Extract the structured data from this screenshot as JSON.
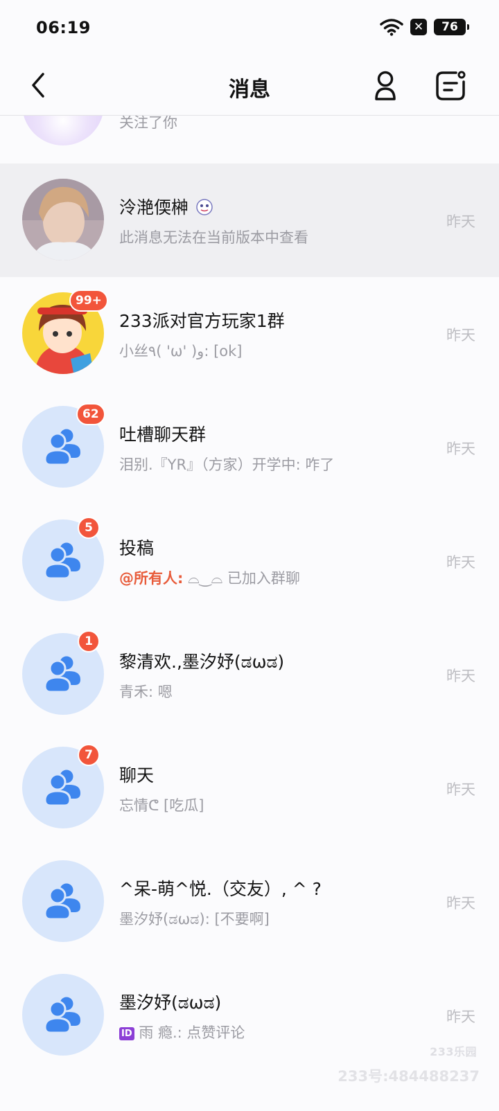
{
  "status_bar": {
    "time": "06:19",
    "battery": "76",
    "wifi_icon": "wifi-icon",
    "x_icon": "close-box-icon"
  },
  "header": {
    "title": "消息",
    "back_icon": "chevron-left-icon",
    "user_icon": "person-icon",
    "message_icon": "message-settings-icon"
  },
  "partial_item": {
    "subtitle": "关注了你"
  },
  "conversations": [
    {
      "title": "泠滟偄榊",
      "subtitle": "此消息无法在当前版本中查看",
      "time": "昨天"
    },
    {
      "title": "233派对官方玩家1群",
      "subtitle": "小丝٩( 'ω' )و: [ok]",
      "time": "昨天",
      "badge": "99+"
    },
    {
      "title": "吐槽聊天群",
      "subtitle": "泪别.『YR』（方家）开学中: 咋了",
      "time": "昨天",
      "badge": "62"
    },
    {
      "title": "投稿",
      "mention": "@所有人:",
      "subtitle": "⌓‿⌓ 已加入群聊",
      "time": "昨天",
      "badge": "5"
    },
    {
      "title": "黎清欢.,墨汐妤(ಡωಡ)",
      "subtitle": "青禾: 嗯",
      "time": "昨天",
      "badge": "1"
    },
    {
      "title": "聊天",
      "subtitle": "忘情ᕦ [吃瓜]",
      "time": "昨天",
      "badge": "7"
    },
    {
      "title": "^呆-萌^悦.（交友）, ^ ?",
      "subtitle": "墨汐妤(ಡωಡ): [不要啊]",
      "time": "昨天"
    },
    {
      "title": "墨汐妤(ಡωಡ)",
      "id_tag": "ID",
      "subtitle": "雨 瘾.: 点赞评论",
      "time": "昨天"
    }
  ],
  "watermark": {
    "brand": "233乐园",
    "account": "233号:484488237"
  },
  "colors": {
    "badge": "#f2553b",
    "group_avatar_bg": "#d8e6fb",
    "group_icon": "#3e86ee",
    "mention": "#e85c3b",
    "highlight_row": "#efeff2"
  }
}
